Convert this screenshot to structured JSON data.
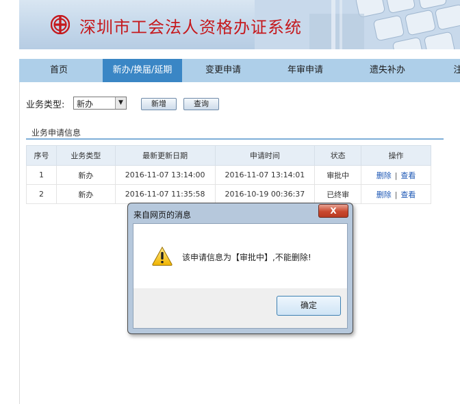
{
  "header": {
    "title": "深圳市工会法人资格办证系统"
  },
  "nav": {
    "items": [
      {
        "label": "首页"
      },
      {
        "label": "新办/换届/延期"
      },
      {
        "label": "变更申请"
      },
      {
        "label": "年审申请"
      },
      {
        "label": "遗失补办"
      },
      {
        "label": "注"
      }
    ],
    "active_index": 1
  },
  "filter": {
    "label": "业务类型:",
    "select_value": "新办",
    "add_button": "新增",
    "query_button": "查询"
  },
  "section": {
    "title": "业务申请信息"
  },
  "table": {
    "headers": [
      "序号",
      "业务类型",
      "最新更新日期",
      "申请时间",
      "状态",
      "操作"
    ],
    "rows": [
      {
        "no": "1",
        "type": "新办",
        "updated": "2016-11-07 13:14:00",
        "applied": "2016-11-07 13:14:01",
        "status": "审批中",
        "delete": "删除",
        "sep": "|",
        "view": "查看"
      },
      {
        "no": "2",
        "type": "新办",
        "updated": "2016-11-07 11:35:58",
        "applied": "2016-10-19 00:36:37",
        "status": "已终审",
        "delete": "删除",
        "sep": "|",
        "view": "查看"
      }
    ]
  },
  "dialog": {
    "title": "来自网页的消息",
    "close_label": "X",
    "message": "该申请信息为【审批中】,不能删除!",
    "ok_button": "确定",
    "icon": "warning-icon"
  },
  "colors": {
    "title_red": "#c5191d",
    "nav_bg": "#aecfe9",
    "nav_active": "#3a86c5",
    "link_blue": "#1c57b5"
  }
}
